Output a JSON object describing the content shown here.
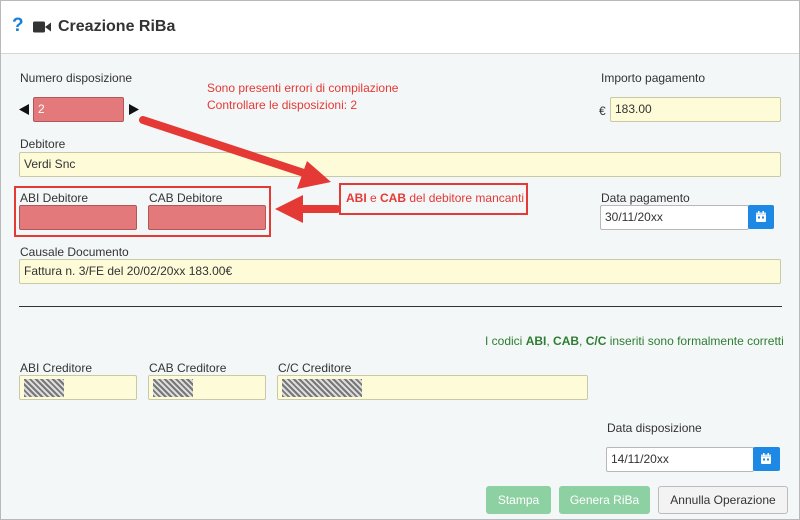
{
  "title": "Creazione RiBa",
  "fields": {
    "numero_label": "Numero disposizione",
    "numero_value": "2",
    "importo_label": "Importo pagamento",
    "currency_symbol": "€",
    "importo_value": "183.00",
    "debitore_label": "Debitore",
    "debitore_value": "Verdi Snc",
    "abi_debitore_label": "ABI Debitore",
    "abi_debitore_value": "",
    "cab_debitore_label": "CAB Debitore",
    "cab_debitore_value": "",
    "data_pagamento_label": "Data pagamento",
    "data_pagamento_value": "30/11/20xx",
    "causale_label": "Causale Documento",
    "causale_value": "Fattura n. 3/FE del 20/02/20xx 183.00€",
    "abi_creditore_label": "ABI Creditore",
    "cab_creditore_label": "CAB Creditore",
    "cc_creditore_label": "C/C Creditore",
    "data_disposizione_label": "Data disposizione",
    "data_disposizione_value": "14/11/20xx"
  },
  "messages": {
    "error_line1": "Sono presenti errori di compilazione",
    "error_line2": "Controllare le disposizioni: 2",
    "callout_abi": "ABI",
    "callout_e": " e ",
    "callout_cab": "CAB",
    "callout_rest": " del debitore mancanti",
    "ok_prefix": "I codici ",
    "ok_abi": "ABI",
    "ok_sep1": ", ",
    "ok_cab": "CAB",
    "ok_sep2": ", ",
    "ok_cc": "C/C",
    "ok_suffix": " inseriti sono formalmente corretti"
  },
  "buttons": {
    "stampa": "Stampa",
    "genera": "Genera RiBa",
    "annulla": "Annulla Operazione"
  },
  "colors": {
    "accent": "#1e88e5",
    "error": "#e53935",
    "ok": "#2e7d32",
    "input_bg": "#fefbd8",
    "input_error_bg": "#e3797b"
  }
}
